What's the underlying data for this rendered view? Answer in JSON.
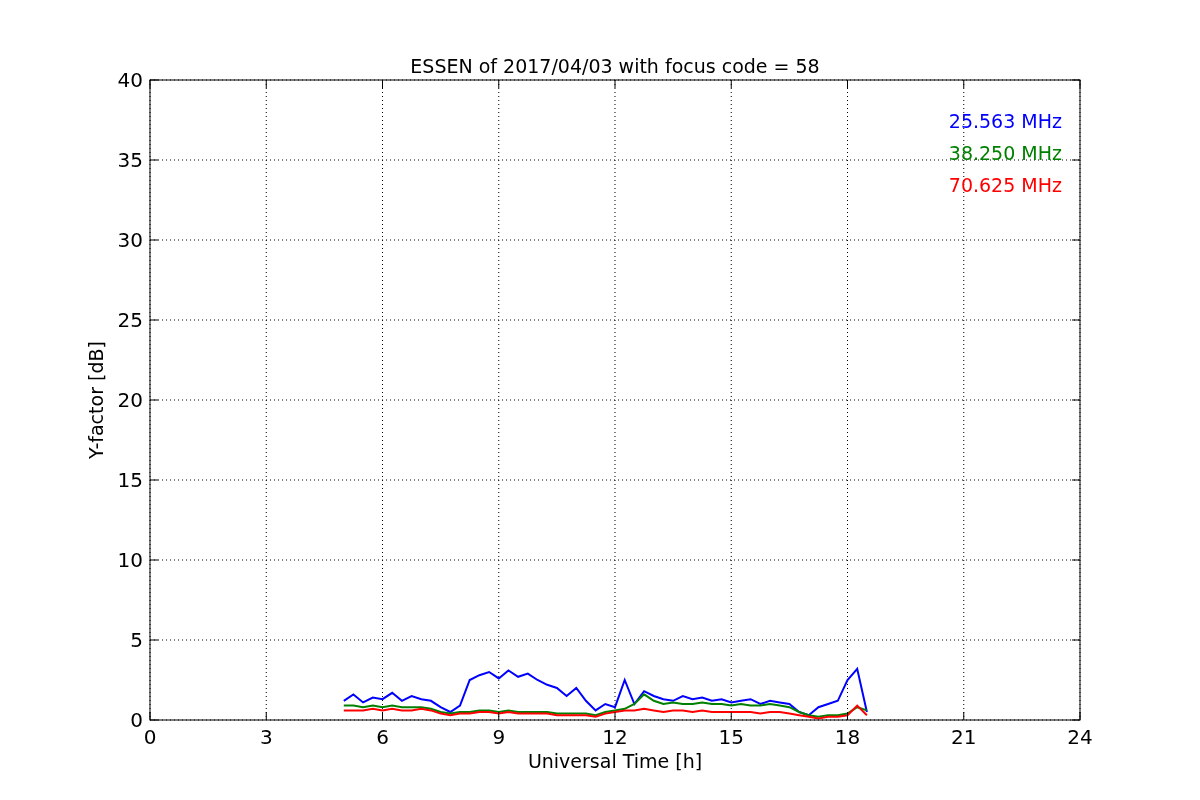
{
  "chart_data": {
    "type": "line",
    "grid": true,
    "title": "ESSEN of 2017/04/03 with focus code = 58",
    "xlabel": "Universal Time [h]",
    "ylabel": "Y-factor [dB]",
    "xlim": [
      0,
      24
    ],
    "ylim": [
      0,
      40
    ],
    "xticks": [
      0,
      3,
      6,
      9,
      12,
      15,
      18,
      21,
      24
    ],
    "yticks": [
      0,
      5,
      10,
      15,
      20,
      25,
      30,
      35,
      40
    ],
    "x": [
      5,
      5.25,
      5.5,
      5.75,
      6,
      6.25,
      6.5,
      6.75,
      7,
      7.25,
      7.5,
      7.75,
      8,
      8.25,
      8.5,
      8.75,
      9,
      9.25,
      9.5,
      9.75,
      10,
      10.25,
      10.5,
      10.75,
      11,
      11.25,
      11.5,
      11.75,
      12,
      12.25,
      12.5,
      12.75,
      13,
      13.25,
      13.5,
      13.75,
      14,
      14.25,
      14.5,
      14.75,
      15,
      15.25,
      15.5,
      15.75,
      16,
      16.25,
      16.5,
      16.75,
      17,
      17.25,
      17.5,
      17.75,
      18,
      18.25,
      18.5
    ],
    "series": [
      {
        "name": "25.563 MHz",
        "color": "#0000ff",
        "values": [
          1.2,
          1.6,
          1.1,
          1.4,
          1.3,
          1.7,
          1.2,
          1.5,
          1.3,
          1.2,
          0.8,
          0.5,
          0.9,
          2.5,
          2.8,
          3.0,
          2.6,
          3.1,
          2.7,
          2.9,
          2.5,
          2.2,
          2.0,
          1.5,
          2.0,
          1.2,
          0.6,
          1.0,
          0.8,
          2.5,
          1.0,
          1.8,
          1.5,
          1.3,
          1.2,
          1.5,
          1.3,
          1.4,
          1.2,
          1.3,
          1.1,
          1.2,
          1.3,
          1.0,
          1.2,
          1.1,
          1.0,
          0.5,
          0.3,
          0.8,
          1.0,
          1.2,
          2.5,
          3.2,
          0.5
        ]
      },
      {
        "name": "38.250 MHz",
        "color": "#008000",
        "values": [
          0.9,
          0.9,
          0.8,
          0.9,
          0.8,
          0.9,
          0.8,
          0.8,
          0.8,
          0.7,
          0.5,
          0.4,
          0.5,
          0.5,
          0.6,
          0.6,
          0.5,
          0.6,
          0.5,
          0.5,
          0.5,
          0.5,
          0.4,
          0.4,
          0.4,
          0.4,
          0.3,
          0.5,
          0.6,
          0.7,
          1.0,
          1.6,
          1.2,
          1.0,
          1.1,
          1.0,
          1.0,
          1.1,
          1.0,
          1.0,
          0.9,
          1.0,
          0.9,
          0.9,
          1.0,
          0.9,
          0.8,
          0.5,
          0.3,
          0.2,
          0.3,
          0.3,
          0.4,
          0.8,
          0.6
        ]
      },
      {
        "name": "70.625 MHz",
        "color": "#ff0000",
        "values": [
          0.6,
          0.6,
          0.6,
          0.7,
          0.6,
          0.7,
          0.6,
          0.6,
          0.7,
          0.6,
          0.4,
          0.3,
          0.4,
          0.4,
          0.5,
          0.5,
          0.4,
          0.5,
          0.4,
          0.4,
          0.4,
          0.4,
          0.3,
          0.3,
          0.3,
          0.3,
          0.2,
          0.4,
          0.5,
          0.6,
          0.6,
          0.7,
          0.6,
          0.5,
          0.6,
          0.6,
          0.5,
          0.6,
          0.5,
          0.5,
          0.5,
          0.5,
          0.5,
          0.4,
          0.5,
          0.5,
          0.4,
          0.3,
          0.2,
          0.1,
          0.2,
          0.2,
          0.3,
          0.9,
          0.3
        ]
      }
    ]
  }
}
